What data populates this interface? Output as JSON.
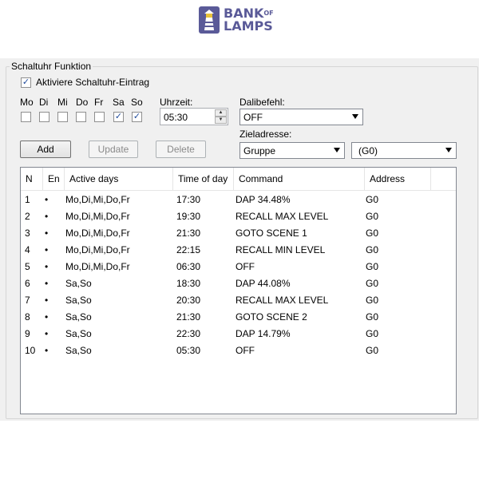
{
  "logo": {
    "line1": "BANK",
    "of": "OF",
    "line2": "LAMPS"
  },
  "group_title": "Schaltuhr Funktion",
  "activate": {
    "label": "Aktiviere Schaltuhr-Eintrag",
    "checked": true
  },
  "days": [
    {
      "label": "Mo",
      "checked": false
    },
    {
      "label": "Di",
      "checked": false
    },
    {
      "label": "Mi",
      "checked": false
    },
    {
      "label": "Do",
      "checked": false
    },
    {
      "label": "Fr",
      "checked": false
    },
    {
      "label": "Sa",
      "checked": true
    },
    {
      "label": "So",
      "checked": true
    }
  ],
  "time": {
    "label": "Uhrzeit:",
    "value": "05:30"
  },
  "dali": {
    "label": "Dalibefehl:",
    "value": "OFF"
  },
  "target": {
    "label": "Zieladresse:",
    "type_value": "Gruppe",
    "address_value": "(G0)"
  },
  "buttons": {
    "add": "Add",
    "update": "Update",
    "delete": "Delete"
  },
  "table": {
    "columns": [
      "N",
      "En",
      "Active days",
      "Time of day",
      "Command",
      "Address"
    ],
    "rows": [
      [
        "1",
        "•",
        "Mo,Di,Mi,Do,Fr",
        "17:30",
        "DAP 34.48%",
        "G0"
      ],
      [
        "2",
        "•",
        "Mo,Di,Mi,Do,Fr",
        "19:30",
        "RECALL MAX LEVEL",
        "G0"
      ],
      [
        "3",
        "•",
        "Mo,Di,Mi,Do,Fr",
        "21:30",
        "GOTO SCENE 1",
        "G0"
      ],
      [
        "4",
        "•",
        "Mo,Di,Mi,Do,Fr",
        "22:15",
        "RECALL MIN LEVEL",
        "G0"
      ],
      [
        "5",
        "•",
        "Mo,Di,Mi,Do,Fr",
        "06:30",
        "OFF",
        "G0"
      ],
      [
        "6",
        "•",
        "Sa,So",
        "18:30",
        "DAP 44.08%",
        "G0"
      ],
      [
        "7",
        "•",
        "Sa,So",
        "20:30",
        "RECALL MAX LEVEL",
        "G0"
      ],
      [
        "8",
        "•",
        "Sa,So",
        "21:30",
        "GOTO SCENE 2",
        "G0"
      ],
      [
        "9",
        "•",
        "Sa,So",
        "22:30",
        "DAP 14.79%",
        "G0"
      ],
      [
        "10",
        "•",
        "Sa,So",
        "05:30",
        "OFF",
        "G0"
      ]
    ]
  }
}
